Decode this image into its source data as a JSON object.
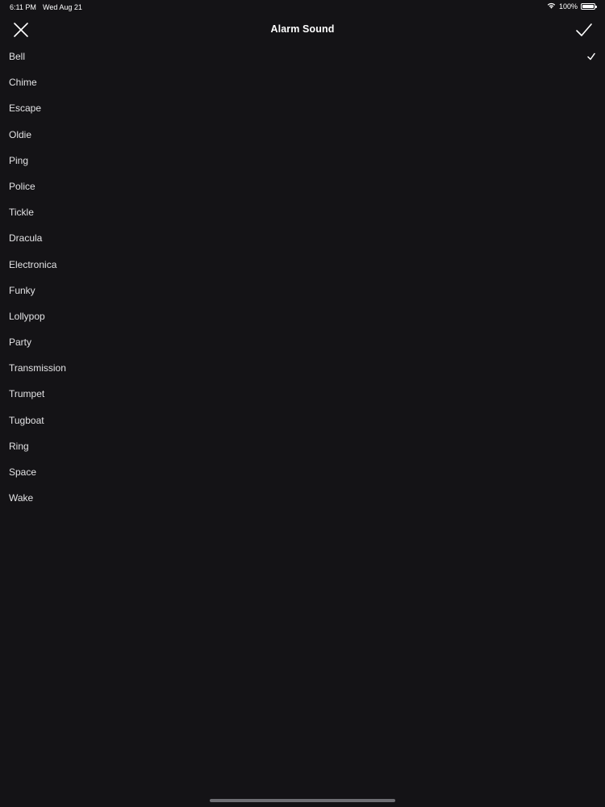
{
  "status_bar": {
    "time": "6:11 PM",
    "date": "Wed Aug 21",
    "battery_text": "100%",
    "battery_level": 1.0,
    "wifi_icon": "wifi-icon"
  },
  "nav": {
    "title": "Alarm Sound",
    "close_icon": "close-icon",
    "confirm_icon": "checkmark-icon"
  },
  "sounds": [
    {
      "label": "Bell",
      "selected": true
    },
    {
      "label": "Chime",
      "selected": false
    },
    {
      "label": "Escape",
      "selected": false
    },
    {
      "label": "Oldie",
      "selected": false
    },
    {
      "label": "Ping",
      "selected": false
    },
    {
      "label": "Police",
      "selected": false
    },
    {
      "label": "Tickle",
      "selected": false
    },
    {
      "label": "Dracula",
      "selected": false
    },
    {
      "label": "Electronica",
      "selected": false
    },
    {
      "label": "Funky",
      "selected": false
    },
    {
      "label": "Lollypop",
      "selected": false
    },
    {
      "label": "Party",
      "selected": false
    },
    {
      "label": "Transmission",
      "selected": false
    },
    {
      "label": "Trumpet",
      "selected": false
    },
    {
      "label": "Tugboat",
      "selected": false
    },
    {
      "label": "Ring",
      "selected": false
    },
    {
      "label": "Space",
      "selected": false
    },
    {
      "label": "Wake",
      "selected": false
    }
  ],
  "colors": {
    "background": "#141316",
    "text": "#e2e2e4",
    "home_indicator": "#6e6e73"
  }
}
